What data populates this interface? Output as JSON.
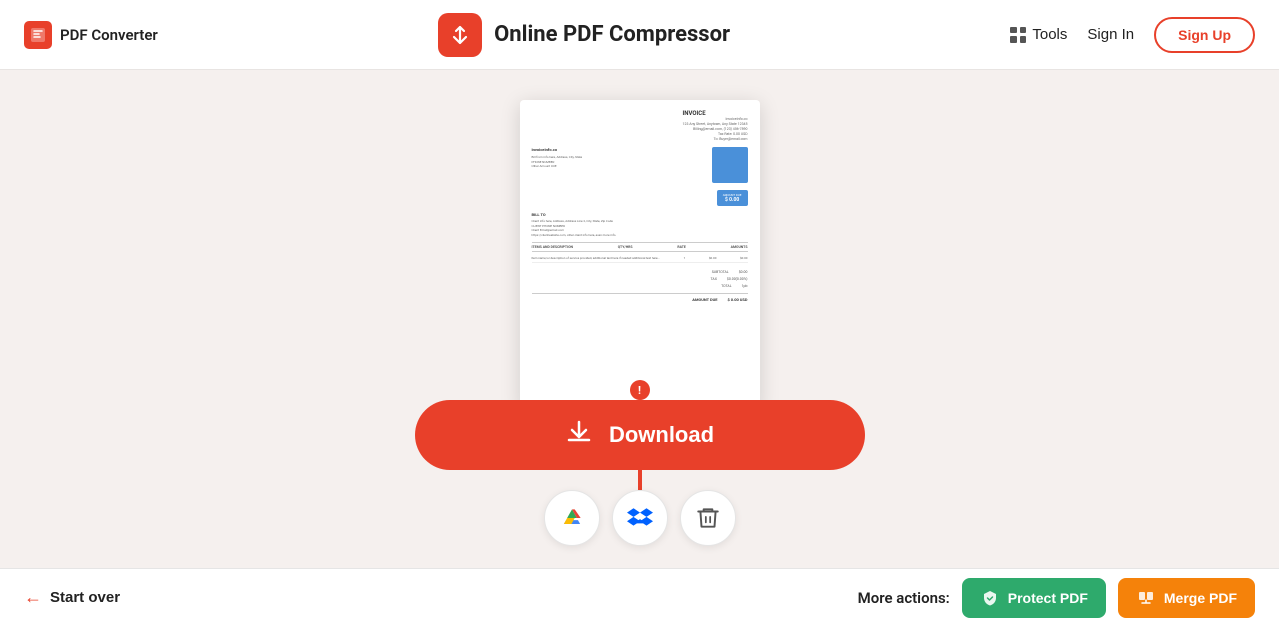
{
  "header": {
    "brand_label": "PDF Converter",
    "title": "Online PDF Compressor",
    "tools_label": "Tools",
    "signin_label": "Sign In",
    "signup_label": "Sign Up"
  },
  "download": {
    "button_label": "Download"
  },
  "storage": {
    "google_drive_label": "google-drive-icon",
    "dropbox_label": "dropbox-icon",
    "delete_label": "delete-icon"
  },
  "bottom": {
    "start_over_label": "Start over",
    "more_actions_label": "More actions:",
    "protect_label": "Protect PDF",
    "merge_label": "Merge PDF"
  },
  "invoice": {
    "title": "INVOICE",
    "amount": "$ 0.00",
    "amount_due_label": "AMOUNT DUE",
    "amount_due": "$ 0.00 USD",
    "bill_to": "BILL TO",
    "subtotal": "SUBTOTAL",
    "total": "TOTAL",
    "items_header": "ITEMS AND DESCRIPTION"
  }
}
